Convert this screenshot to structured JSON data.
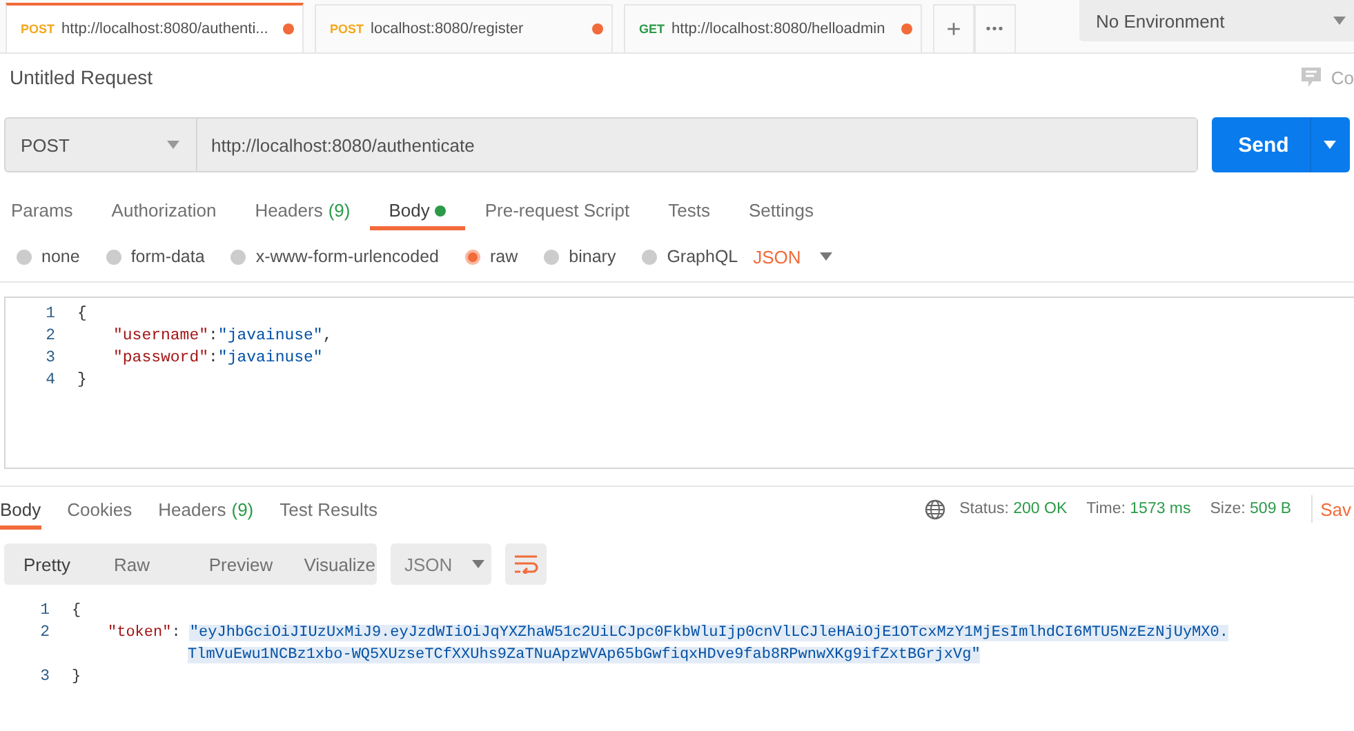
{
  "tabs": [
    {
      "method": "POST",
      "color": "#f4a81d",
      "label": "http://localhost:8080/authenti...",
      "unsaved": true,
      "selected": true
    },
    {
      "method": "POST",
      "color": "#f4a81d",
      "label": "localhost:8080/register",
      "unsaved": true,
      "selected": false
    },
    {
      "method": "GET",
      "color": "#2c9a49",
      "label": "http://localhost:8080/helloadmin",
      "unsaved": true,
      "selected": false
    }
  ],
  "new_tab": "+",
  "more_tabs": "•••",
  "environment": {
    "value": "No Environment"
  },
  "request_title": "Untitled Request",
  "comments_label": "Co",
  "request": {
    "method": "POST",
    "url": "http://localhost:8080/authenticate",
    "send": "Send"
  },
  "request_tabs": [
    {
      "label": "Params",
      "selected": false
    },
    {
      "label": "Authorization",
      "selected": false
    },
    {
      "label": "Headers",
      "count": "(9)",
      "selected": false
    },
    {
      "label": "Body",
      "dot": true,
      "selected": true
    },
    {
      "label": "Pre-request Script",
      "selected": false
    },
    {
      "label": "Tests",
      "selected": false
    },
    {
      "label": "Settings",
      "selected": false
    }
  ],
  "body_types": [
    {
      "label": "none",
      "selected": false
    },
    {
      "label": "form-data",
      "selected": false
    },
    {
      "label": "x-www-form-urlencoded",
      "selected": false
    },
    {
      "label": "raw",
      "selected": true
    },
    {
      "label": "binary",
      "selected": false
    },
    {
      "label": "GraphQL",
      "selected": false
    }
  ],
  "body_format": "JSON",
  "request_body": [
    {
      "number": "1",
      "parts": [
        {
          "kind": "punct",
          "text": "{"
        }
      ]
    },
    {
      "number": "2",
      "parts": [
        {
          "kind": "key",
          "text": "\"username\""
        },
        {
          "kind": "punct",
          "text": ":"
        },
        {
          "kind": "string",
          "text": "\"javainuse\""
        },
        {
          "kind": "punct",
          "text": ","
        }
      ]
    },
    {
      "number": "3",
      "parts": [
        {
          "kind": "key",
          "text": "\"password\""
        },
        {
          "kind": "punct",
          "text": ":"
        },
        {
          "kind": "string",
          "text": "\"javainuse\""
        }
      ]
    },
    {
      "number": "4",
      "parts": [
        {
          "kind": "punct",
          "text": "}"
        }
      ]
    }
  ],
  "response_tabs": [
    {
      "label": "Body",
      "selected": true
    },
    {
      "label": "Cookies",
      "selected": false
    },
    {
      "label": "Headers",
      "count": "(9)",
      "selected": false
    },
    {
      "label": "Test Results",
      "selected": false
    }
  ],
  "response_status": [
    {
      "label": "Status:",
      "value": "200 OK"
    },
    {
      "label": "Time:",
      "value": "1573 ms"
    },
    {
      "label": "Size:",
      "value": "509 B"
    }
  ],
  "save_label": "Sav",
  "view_modes": [
    {
      "label": "Pretty",
      "selected": true
    },
    {
      "label": "Raw",
      "selected": false
    },
    {
      "label": "Preview",
      "selected": false
    },
    {
      "label": "Visualize",
      "selected": false
    }
  ],
  "response_format": "JSON",
  "response_body": [
    {
      "number": "1",
      "lines": [
        [
          {
            "kind": "punct",
            "text": "{"
          }
        ]
      ]
    },
    {
      "number": "2",
      "lines": [
        [
          {
            "kind": "key",
            "text": "\"token\""
          },
          {
            "kind": "punct",
            "text": ": "
          },
          {
            "kind": "string",
            "text": "\"eyJhbGciOiJIUzUxMiJ9.eyJzdWIiOiJqYXZhaW51c2UiLCJpc0FkbWluIjp0cnVlLCJleHAiOjE1OTcxMzY1MjEsImlhdCI6MTU5NzEzNjUyMX0."
          }
        ],
        [
          {
            "kind": "string",
            "text": "TlmVuEwu1NCBz1xbo-WQ5XUzseTCfXXUhs9ZaTNuApzWVAp65bGwfiqxHDve9fab8RPwnwXKg9ifZxtBGrjxVg\""
          }
        ]
      ]
    },
    {
      "number": "3",
      "lines": [
        [
          {
            "kind": "punct",
            "text": "}"
          }
        ]
      ]
    }
  ]
}
